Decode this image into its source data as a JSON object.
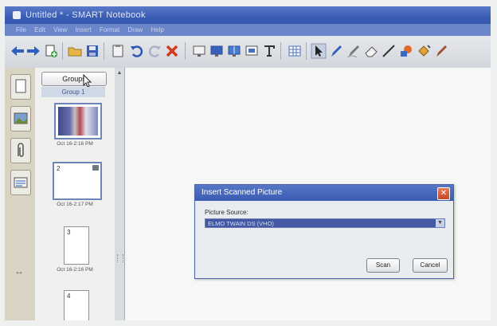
{
  "window": {
    "title": "Untitled * - SMART Notebook"
  },
  "menu": [
    "File",
    "Edit",
    "View",
    "Insert",
    "Format",
    "Draw",
    "Help"
  ],
  "toolbar": {
    "icons": [
      "back-arrow",
      "forward-arrow",
      "add-page",
      "open-folder",
      "save",
      "paste",
      "undo",
      "redo",
      "delete",
      "screen-shade",
      "full-screen",
      "dual-page",
      "capture",
      "table",
      "select",
      "pen",
      "creative-pen",
      "eraser",
      "line",
      "shapes",
      "fill",
      "magic-pen"
    ]
  },
  "sidebar": {
    "groups_button": "Groups",
    "group_label": "Group 1",
    "pages": [
      {
        "number": "",
        "time": "Oct 16-2:16 PM",
        "has_photo": true
      },
      {
        "number": "2",
        "time": "Oct 16-2:17 PM",
        "has_photo": false
      },
      {
        "number": "3",
        "time": "Oct 16-2:16 PM",
        "has_photo": false
      },
      {
        "number": "4",
        "time": "",
        "has_photo": false
      }
    ]
  },
  "dialog": {
    "title": "Insert Scanned Picture",
    "source_label": "Picture Source:",
    "source_value": "ELMO TWAIN DS (VHO)",
    "scan_button": "Scan",
    "cancel_button": "Cancel",
    "close_glyph": "✕"
  },
  "colors": {
    "titlebar": "#3a5db4",
    "dialog_title": "#3a5cb2",
    "close_button": "#c64523",
    "selection": "#4358a3"
  }
}
